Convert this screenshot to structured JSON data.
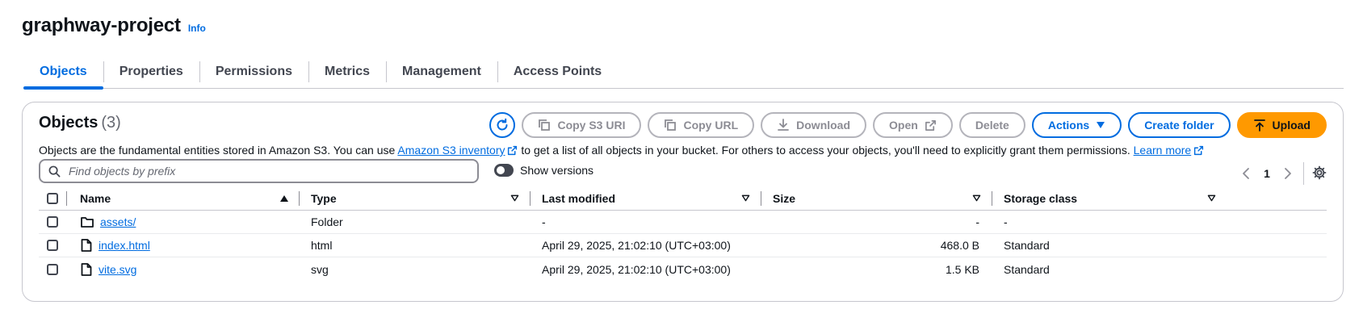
{
  "bucket": {
    "title": "graphway-project",
    "info": "Info"
  },
  "tabs": [
    "Objects",
    "Properties",
    "Permissions",
    "Metrics",
    "Management",
    "Access Points"
  ],
  "objects_panel": {
    "title": "Objects",
    "count": "(3)",
    "description_before": "Objects are the fundamental entities stored in Amazon S3. You can use ",
    "inventory_link": "Amazon S3 inventory",
    "description_middle": " to get a list of all objects in your bucket. For others to access your objects, you'll need to explicitly grant them permissions. ",
    "learn_more": "Learn more"
  },
  "toolbar": {
    "copy_s3_uri": "Copy S3 URI",
    "copy_url": "Copy URL",
    "download": "Download",
    "open": "Open",
    "delete": "Delete",
    "actions": "Actions",
    "create_folder": "Create folder",
    "upload": "Upload"
  },
  "search": {
    "placeholder": "Find objects by prefix"
  },
  "show_versions": {
    "label": "Show versions",
    "enabled": false
  },
  "pagination": {
    "page": "1"
  },
  "columns": {
    "name": "Name",
    "type": "Type",
    "last_modified": "Last modified",
    "size": "Size",
    "storage_class": "Storage class"
  },
  "rows": [
    {
      "icon": "folder-icon",
      "name": "assets/",
      "type": "Folder",
      "last_modified": "-",
      "size": "-",
      "storage_class": "-"
    },
    {
      "icon": "file-icon",
      "name": "index.html",
      "type": "html",
      "last_modified": "April 29, 2025, 21:02:10 (UTC+03:00)",
      "size": "468.0 B",
      "storage_class": "Standard"
    },
    {
      "icon": "file-icon",
      "name": "vite.svg",
      "type": "svg",
      "last_modified": "April 29, 2025, 21:02:10 (UTC+03:00)",
      "size": "1.5 KB",
      "storage_class": "Standard"
    }
  ],
  "colors": {
    "link": "#006ce0",
    "primary": "#ff9900",
    "text": "#0f141a"
  }
}
